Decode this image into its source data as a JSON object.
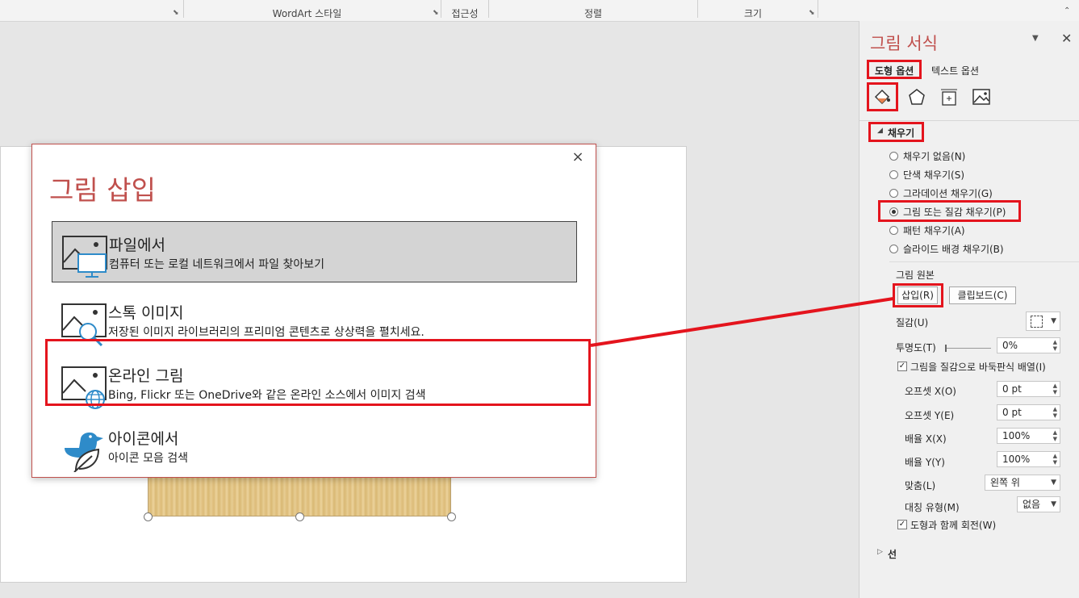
{
  "ribbon": {
    "groups": [
      "WordArt 스타일",
      "접근성",
      "정렬",
      "크기"
    ]
  },
  "dialog": {
    "title": "그림 삽입",
    "close": "×",
    "options": [
      {
        "title": "파일에서",
        "desc": "컴퓨터 또는 로컬 네트워크에서 파일 찾아보기",
        "icon": "picture-computer-icon"
      },
      {
        "title": "스톡 이미지",
        "desc": "저장된 이미지 라이브러리의 프리미엄 콘텐츠로 상상력을 펼치세요.",
        "icon": "picture-search-icon"
      },
      {
        "title": "온라인 그림",
        "desc": "Bing, Flickr 또는 OneDrive와 같은 온라인 소스에서 이미지 검색",
        "icon": "picture-globe-icon"
      },
      {
        "title": "아이콘에서",
        "desc": "아이콘 모음 검색",
        "icon": "bird-leaf-icon"
      }
    ]
  },
  "pane": {
    "title": "그림 서식",
    "tab_shape": "도형 옵션",
    "tab_text": "텍스트 옵션",
    "section_fill": "채우기",
    "fill_options": [
      "채우기 없음(N)",
      "단색 채우기(S)",
      "그라데이션 채우기(G)",
      "그림 또는 질감 채우기(P)",
      "패턴 채우기(A)",
      "슬라이드 배경 채우기(B)"
    ],
    "fill_selected": "그림 또는 질감 채우기(P)",
    "picture_source": "그림 원본",
    "insert_button": "삽입(R)",
    "clipboard_button": "클립보드(C)",
    "texture_label": "질감(U)",
    "transparency_label": "투명도(T)",
    "transparency_value": "0%",
    "tile_checkbox": "그림을 질감으로 바둑판식 배열(I)",
    "offset_x_label": "오프셋 X(O)",
    "offset_x_value": "0 pt",
    "offset_y_label": "오프셋 Y(E)",
    "offset_y_value": "0 pt",
    "scale_x_label": "배율 X(X)",
    "scale_x_value": "100%",
    "scale_y_label": "배율 Y(Y)",
    "scale_y_value": "100%",
    "align_label": "맞춤(L)",
    "align_value": "왼쪽 위",
    "mirror_label": "대칭 유형(M)",
    "mirror_value": "없음",
    "rotate_checkbox": "도형과 함께 회전(W)",
    "section_line": "선"
  },
  "colors": {
    "accent": "#c0504d",
    "callout": "#e4141d",
    "selected_option_bg": "#d4d4d4",
    "icon_blue": "#2e8bc9"
  }
}
